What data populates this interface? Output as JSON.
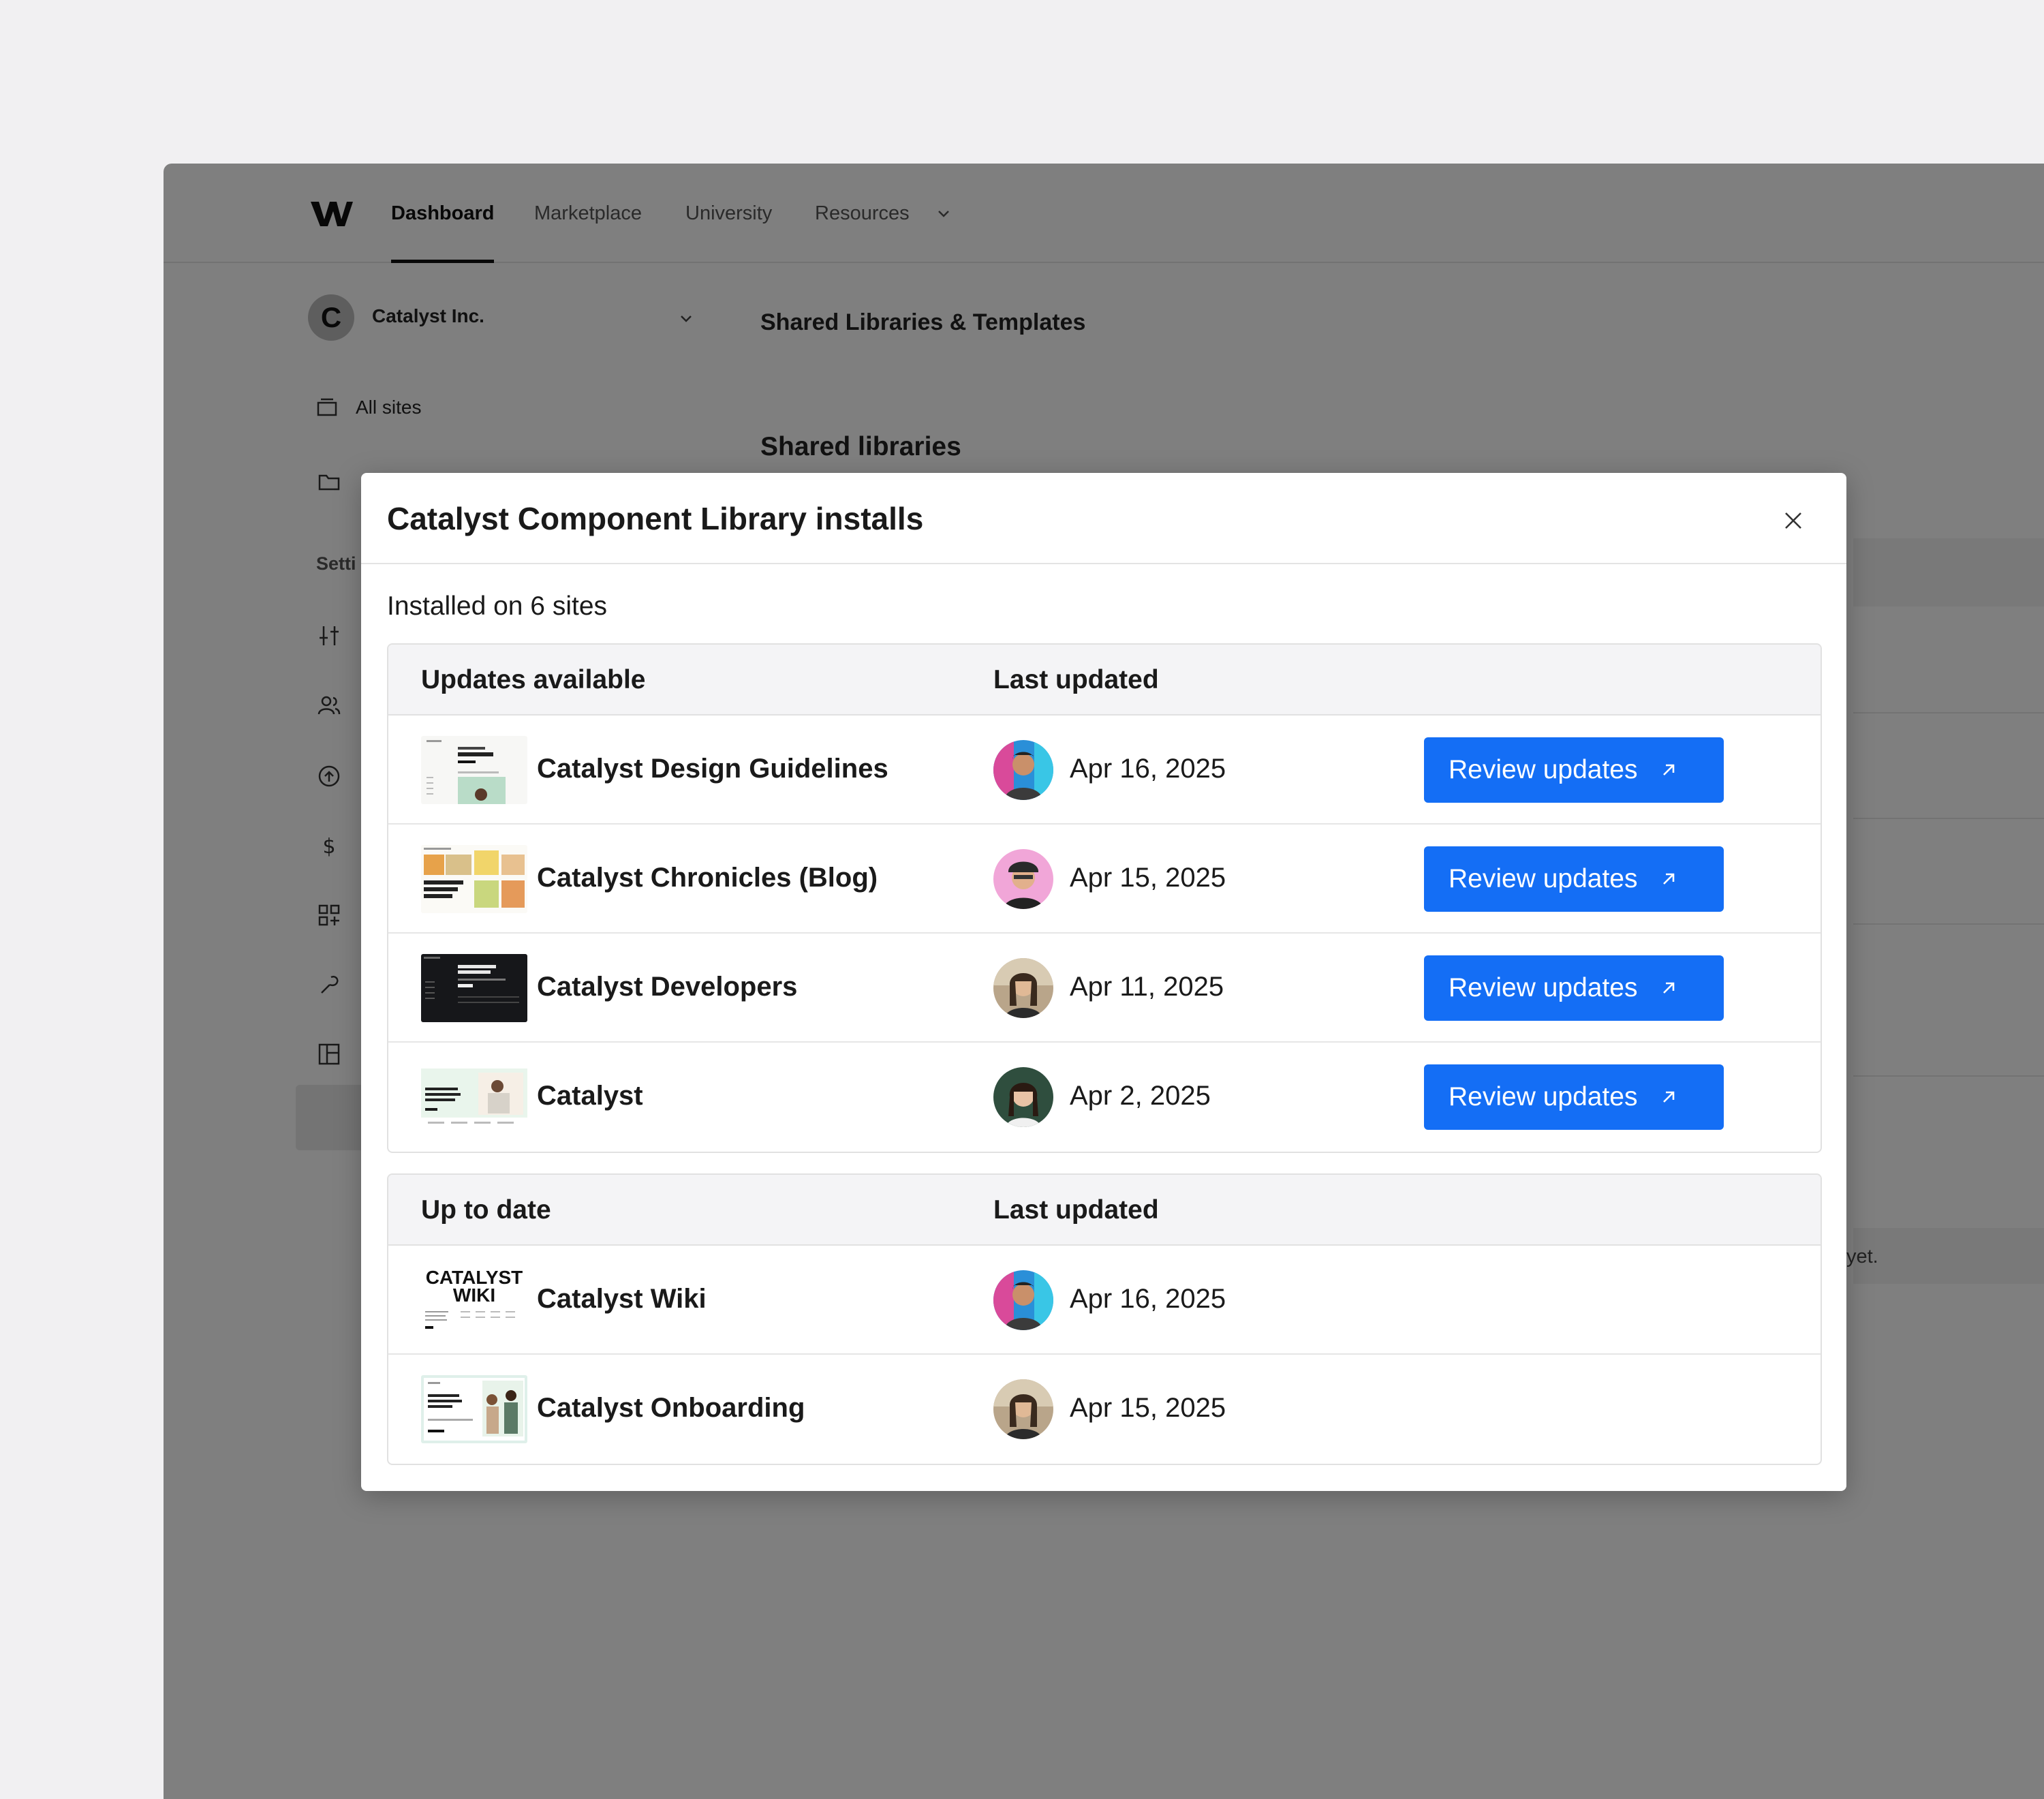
{
  "nav": {
    "items": [
      "Dashboard",
      "Marketplace",
      "University",
      "Resources"
    ],
    "active": "Dashboard"
  },
  "workspace": {
    "initial": "C",
    "name": "Catalyst Inc."
  },
  "sidebar": {
    "all_sites": "All sites",
    "settings_heading": "Setti"
  },
  "page": {
    "title": "Shared Libraries & Templates",
    "section": "Shared libraries",
    "bg_fragment": "yet."
  },
  "modal": {
    "title": "Catalyst Component Library installs",
    "installed": "Installed on 6 sites",
    "updates_section": {
      "header_name": "Updates available",
      "header_date": "Last updated",
      "rows": [
        {
          "name": "Catalyst Design Guidelines",
          "date": "Apr 16, 2025",
          "button": "Review updates"
        },
        {
          "name": "Catalyst Chronicles (Blog)",
          "date": "Apr 15, 2025",
          "button": "Review updates"
        },
        {
          "name": "Catalyst Developers",
          "date": "Apr 11, 2025",
          "button": "Review updates"
        },
        {
          "name": "Catalyst",
          "date": "Apr 2, 2025",
          "button": "Review updates"
        }
      ]
    },
    "uptodate_section": {
      "header_name": "Up to date",
      "header_date": "Last updated",
      "rows": [
        {
          "name": "Catalyst Wiki",
          "date": "Apr 16, 2025",
          "thumb_text_1": "CATALYST",
          "thumb_text_2": "WIKI"
        },
        {
          "name": "Catalyst Onboarding",
          "date": "Apr 15, 2025"
        }
      ]
    }
  },
  "colors": {
    "accent": "#146ef5",
    "overlay": "rgba(0,0,0,0.5)"
  }
}
